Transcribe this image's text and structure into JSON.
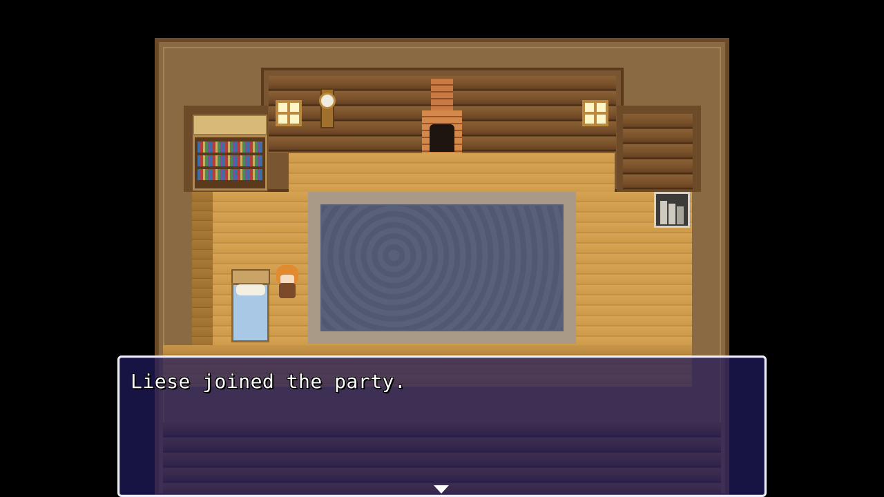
{
  "scene": {
    "location_type": "log cabin interior",
    "objects": [
      "bookshelf",
      "window-left",
      "grandfather-clock",
      "fireplace",
      "window-right",
      "rug",
      "bed",
      "cabinet",
      "character"
    ]
  },
  "dialog": {
    "message": "Liese joined the party.",
    "continue_indicator": "arrow-down-icon"
  },
  "colors": {
    "dialog_background": "#201a5c",
    "dialog_border": "#eef0f6",
    "text": "#ffffff"
  }
}
